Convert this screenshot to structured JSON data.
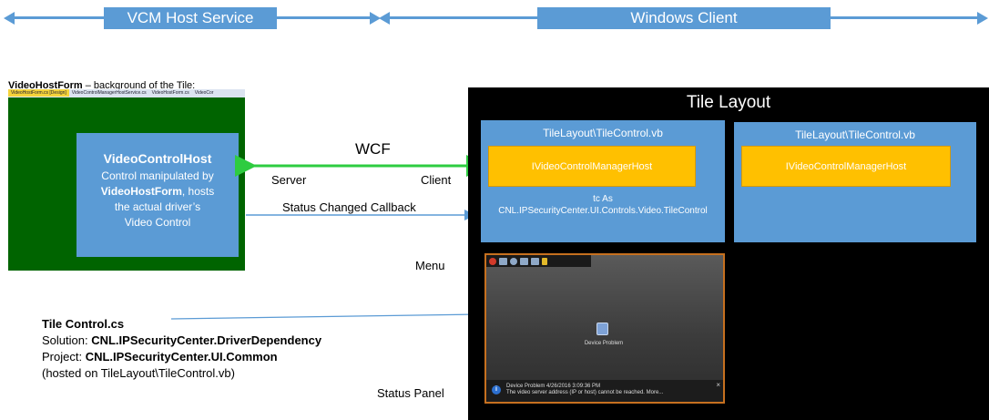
{
  "banner": {
    "left_label": "VCM Host Service",
    "right_label": "Windows Client"
  },
  "video_host_form": {
    "caption_bold": "VideoHostForm",
    "caption_rest": " – background of the Tile:",
    "tabs": [
      "VideoHostForm.cs [Design]",
      "VideoControlManagerHostService.cs",
      "VideoHostForm.cs",
      "VideoCor"
    ],
    "host_box": {
      "title": "VideoControlHost",
      "line1": "Control manipulated by",
      "line2_bold": "VideoHostForm",
      "line2_rest": ", hosts",
      "line3": "the actual driver’s",
      "line4": "Video Control"
    }
  },
  "connections": {
    "wcf": "WCF",
    "server": "Server",
    "client": "Client",
    "status_callback": "Status Changed Callback",
    "menu": "Menu",
    "status_panel": "Status Panel",
    "colors": {
      "wcf_arrow": "#2ecc40",
      "callback_arrow": "#5b9bd5"
    }
  },
  "tile_layout": {
    "title": "Tile Layout",
    "tile1": {
      "header": "TileLayout\\TileControl.vb",
      "host_label": "IVideoControlManagerHost",
      "tc_line1": "tc As",
      "tc_line2": "CNL.IPSecurityCenter.UI.Controls.Video.TileControl"
    },
    "tile2": {
      "header": "TileLayout\\TileControl.vb",
      "host_label": "IVideoControlManagerHost"
    },
    "video": {
      "device_label": "Device Problem",
      "status_line1": "Device Problem 4/26/2016 3:09:36 PM",
      "status_line2": "The video server address (IP or host) cannot be reached.  More...",
      "close": "×",
      "info": "i"
    }
  },
  "tile_control_cs": {
    "title": "Tile Control.cs",
    "solution_label": "Solution: ",
    "solution_value": "CNL.IPSecurityCenter.DriverDependency",
    "project_label": "Project: ",
    "project_value": "CNL.IPSecurityCenter.UI.Common",
    "hosted": "(hosted on TileLayout\\TileControl.vb)"
  }
}
